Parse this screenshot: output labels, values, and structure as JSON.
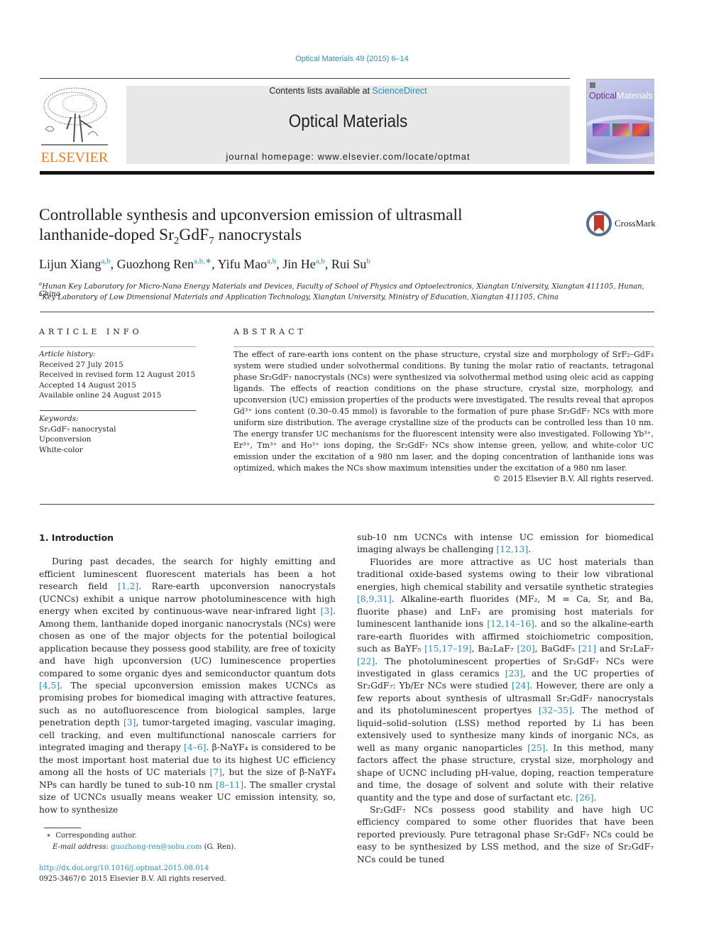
{
  "header": {
    "journal_ref": "Optical Materials 49 (2015) 6–14",
    "contents_prefix": "Contents lists available at ",
    "contents_link": "ScienceDirect",
    "journal_name": "Optical Materials",
    "homepage": "journal homepage: www.elsevier.com/locate/optmat",
    "publisher_logo_text": "ELSEVIER",
    "cover_title_part1": "Optical",
    "cover_title_part2": "Materials",
    "crossmark_label": "CrossMark"
  },
  "article": {
    "title_line1": "Controllable synthesis and upconversion emission of ultrasmall",
    "title_line2_pre": "lanthanide-doped Sr",
    "title_sub1": "2",
    "title_mid": "GdF",
    "title_sub2": "7",
    "title_post": " nanocrystals",
    "authors": [
      {
        "name": "Lijun Xiang",
        "affil": "a,b"
      },
      {
        "name": "Guozhong Ren",
        "affil": "a,b,∗"
      },
      {
        "name": "Yifu Mao",
        "affil": "a,b"
      },
      {
        "name": "Jin He",
        "affil": "a,b"
      },
      {
        "name": "Rui Su",
        "affil": "b"
      }
    ],
    "affiliations": [
      {
        "key": "a",
        "text": "Hunan Key Laboratory for Micro-Nano Energy Materials and Devices, Faculty of School of Physics and Optoelectronics, Xiangtan University, Xiangtan 411105, Hunan, China"
      },
      {
        "key": "b",
        "text": "Key Laboratory of Low Dimensional Materials and Application Technology, Xiangtan University, Ministry of Education, Xiangtan 411105, China"
      }
    ]
  },
  "article_info": {
    "heading": "ARTICLE INFO",
    "history_label": "Article history:",
    "history": [
      "Received 27 July 2015",
      "Received in revised form 12 August 2015",
      "Accepted 14 August 2015",
      "Available online 24 August 2015"
    ],
    "keywords_label": "Keywords:",
    "keywords": [
      "Sr₂GdF₇ nanocrystal",
      "Upconversion",
      "White-color"
    ]
  },
  "abstract": {
    "heading": "ABSTRACT",
    "text": "The effect of rare-earth ions content on the phase structure, crystal size and morphology of SrF₂–GdF₃ system were studied under solvothermal conditions. By tuning the molar ratio of reactants, tetragonal phase Sr₂GdF₇ nanocrystals (NCs) were synthesized via solvothermal method using oleic acid as capping ligands. The effects of reaction conditions on the phase structure, crystal size, morphology, and upconversion (UC) emission properties of the products were investigated. The results reveal that apropos Gd³⁺ ions content (0.30–0.45 mmol) is favorable to the formation of pure phase Sr₂GdF₇ NCs with more uniform size distribution. The average crystalline size of the products can be controlled less than 10 nm. The energy transfer UC mechanisms for the fluorescent intensity were also investigated. Following Yb³⁺, Er³⁺, Tm³⁺ and Ho³⁺ ions doping, the Sr₂GdF₇ NCs show intense green, yellow, and white-color UC emission under the excitation of a 980 nm laser, and the doping concentration of lanthanide ions was optimized, which makes the NCs show maximum intensities under the excitation of a 980 nm laser.",
    "copyright": "© 2015 Elsevier B.V. All rights reserved."
  },
  "body": {
    "section_heading": "1. Introduction",
    "left_paragraph": [
      {
        "t": "During past decades, the search for highly emitting and efficient luminescent fluorescent materials has been a hot research field "
      },
      {
        "c": "[1,2]"
      },
      {
        "t": ". Rare-earth upconversion nanocrystals (UCNCs) exhibit a unique narrow photoluminescence with high energy when excited by continuous-wave near-infrared light "
      },
      {
        "c": "[3]"
      },
      {
        "t": ". Among them, lanthanide doped inorganic nanocrystals (NCs) were chosen as one of the major objects for the potential boilogical application because they possess good stability, are free of toxicity and have high upconversion (UC) luminescence properties compared to some organic dyes and semiconductor quantum dots "
      },
      {
        "c": "[4,5]"
      },
      {
        "t": ". The special upconversion emission makes UCNCs as promising probes for biomedical imaging with attractive features, such as no autofluorescence from biological samples, large penetration depth "
      },
      {
        "c": "[3]"
      },
      {
        "t": ", tumor-targeted imaging, vascular imaging, cell tracking, and even multifunctional nanoscale carriers for integrated imaging and therapy "
      },
      {
        "c": "[4–6]"
      },
      {
        "t": ". β-NaYF₄ is considered to be the most important host material due to its highest UC efficiency among all the hosts of UC materials "
      },
      {
        "c": "[7]"
      },
      {
        "t": ", but the size of β-NaYF₄ NPs can hardly be tuned to sub-10 nm "
      },
      {
        "c": "[8–11]"
      },
      {
        "t": ". The smaller crystal size of UCNCs usually means weaker UC emission intensity, so, how to synthesize"
      }
    ],
    "right_cont": [
      {
        "t": "sub-10 nm UCNCs with intense UC emission for biomedical imaging always be challenging "
      },
      {
        "c": "[12,13]"
      },
      {
        "t": "."
      }
    ],
    "right_paragraph2": [
      {
        "t": "Fluorides are more attractive as UC host materials than traditional oxide-based systems owing to their low vibrational energies, high chemical stability and versatile synthetic strategies "
      },
      {
        "c": "[8,9,31]"
      },
      {
        "t": ". Alkaline-earth fluorides (MF₂, M = Ca, Sr, and Ba, fluorite phase) and LnF₃ are promising host materials for luminescent lanthanide ions "
      },
      {
        "c": "[12,14–16]"
      },
      {
        "t": ". and so the alkaline-earth rare-earth fluorides with affirmed stoichiometric composition, such as BaYF₅ "
      },
      {
        "c": "[15,17–19]"
      },
      {
        "t": ", Ba₂LaF₇ "
      },
      {
        "c": "[20]"
      },
      {
        "t": ", BaGdF₅ "
      },
      {
        "c": "[21]"
      },
      {
        "t": " and Sr₂LaF₇ "
      },
      {
        "c": "[22]"
      },
      {
        "t": ". The photoluminescent properties of Sr₂GdF₇ NCs were investigated in glass ceramics "
      },
      {
        "c": "[23]"
      },
      {
        "t": ", and the UC properties of Sr₂GdF₇: Yb/Er NCs were studied "
      },
      {
        "c": "[24]"
      },
      {
        "t": ". However, there are only a few reports about synthesis of ultrasmall Sr₂GdF₇ nanocrystals and its photoluminescent propertyes "
      },
      {
        "c": "[32–35]"
      },
      {
        "t": ". The method of liquid–solid–solution (LSS) method reported by Li has been extensively used to synthesize many kinds of inorganic NCs, as well as many organic nanoparticles "
      },
      {
        "c": "[25]"
      },
      {
        "t": ". In this method, many factors affect the phase structure, crystal size, morphology and shape of UCNC including pH-value, doping, reaction temperature and time, the dosage of solvent and solute with their relative quantity and the type and dose of surfactant etc. "
      },
      {
        "c": "[26]"
      },
      {
        "t": "."
      }
    ],
    "right_paragraph3": "Sr₂GdF₇ NCs possess good stability and have high UC efficiency compared to some other fluorides that have been reported previously. Pure tetragonal phase Sr₂GdF₇ NCs could be easy to be synthesized by LSS method, and the size of Sr₂GdF₇ NCs could be tuned"
  },
  "footnote": {
    "marker": "∗",
    "corresponding": "Corresponding author.",
    "email_label": "E-mail address:",
    "email": "guozhong-ren@sohu.com",
    "email_suffix": " (G. Ren)."
  },
  "doi": {
    "link": "http://dx.doi.org/10.1016/j.optmat.2015.08.014",
    "issn_line": "0925-3467/© 2015 Elsevier B.V. All rights reserved."
  },
  "colors": {
    "link": "#2a8db8",
    "elsevier_orange": "#f07a1a",
    "banner_bg": "#e8e8e8"
  }
}
